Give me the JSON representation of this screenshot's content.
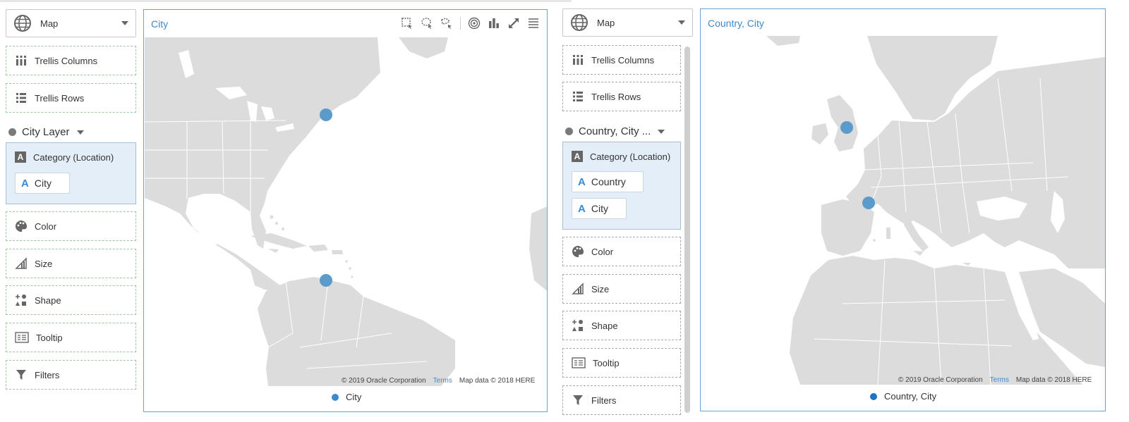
{
  "left_panel": {
    "viz_type": "Map",
    "drops": {
      "trellis_columns": "Trellis Columns",
      "trellis_rows": "Trellis Rows",
      "color": "Color",
      "size": "Size",
      "shape": "Shape",
      "tooltip": "Tooltip",
      "filters": "Filters"
    },
    "layer_name": "City Layer",
    "category_label": "Category (Location)",
    "category_items": [
      "City"
    ]
  },
  "right_panel": {
    "viz_type": "Map",
    "drops": {
      "trellis_columns": "Trellis Columns",
      "trellis_rows": "Trellis Rows",
      "color": "Color",
      "size": "Size",
      "shape": "Shape",
      "tooltip": "Tooltip",
      "filters": "Filters"
    },
    "layer_name": "Country, City ...",
    "category_label": "Category (Location)",
    "category_items": [
      "Country",
      "City"
    ]
  },
  "view1": {
    "title": "City",
    "attribution": "© 2019 Oracle Corporation",
    "terms": "Terms",
    "map_data": "Map data © 2018 HERE",
    "legend": "City",
    "toolbar_icons": [
      "rect-select-icon",
      "lasso-select-icon",
      "freeform-select-icon",
      "target-icon",
      "bar-chart-icon",
      "expand-icon",
      "menu-icon"
    ]
  },
  "view2": {
    "title": "Country, City",
    "attribution": "© 2019 Oracle Corporation",
    "terms": "Terms",
    "map_data": "Map data © 2018 HERE",
    "legend": "Country, City"
  },
  "colors": {
    "accent": "#3b8ad0",
    "marker": "#5b9bcb",
    "land": "#dcdcdc",
    "selection": "#e4eef8"
  }
}
